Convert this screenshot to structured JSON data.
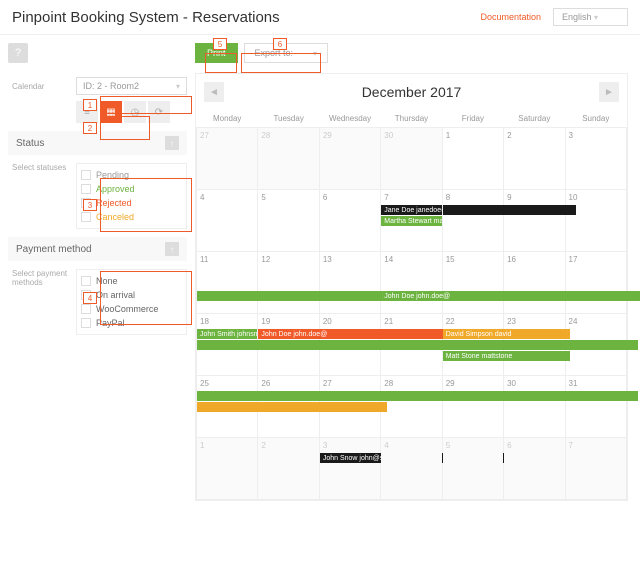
{
  "header": {
    "title": "Pinpoint Booking System - Reservations",
    "docLink": "Documentation",
    "lang": "English"
  },
  "toolbar": {
    "print": "Print",
    "export": "Export to:"
  },
  "sidebar": {
    "calendarLabel": "Calendar",
    "calendarSelect": "ID: 2 - Room2",
    "statusHeader": "Status",
    "statusLabel": "Select statuses",
    "statuses": {
      "pending": "Pending",
      "approved": "Approved",
      "rejected": "Rejected",
      "canceled": "Canceled"
    },
    "paymentHeader": "Payment method",
    "paymentLabel": "Select payment methods",
    "payments": {
      "none": "None",
      "arrival": "On arrival",
      "woo": "WooCommerce",
      "paypal": "PayPal"
    }
  },
  "callouts": {
    "c1": "1",
    "c2": "2",
    "c3": "3",
    "c4": "4",
    "c5": "5",
    "c6": "6"
  },
  "calendar": {
    "title": "December 2017",
    "days": [
      "Monday",
      "Tuesday",
      "Wednesday",
      "Thursday",
      "Friday",
      "Saturday",
      "Sunday"
    ],
    "cells": [
      [
        "27",
        "28",
        "29",
        "30",
        "1",
        "2",
        "3"
      ],
      [
        "4",
        "5",
        "6",
        "7",
        "8",
        "9",
        "10"
      ],
      [
        "11",
        "12",
        "13",
        "14",
        "15",
        "16",
        "17"
      ],
      [
        "18",
        "19",
        "20",
        "21",
        "22",
        "23",
        "24"
      ],
      [
        "25",
        "26",
        "27",
        "28",
        "29",
        "30",
        "31"
      ],
      [
        "1",
        "2",
        "3",
        "4",
        "5",
        "6",
        "7"
      ]
    ],
    "events": {
      "janeDoe": "Jane Doe janedoe@c",
      "martha": "Martha Stewart mart",
      "johnDoe": "John Doe john.doe@",
      "johnSmith": "John Smith johnsmith",
      "johnDoe2": "John Doe john.doe@",
      "davidSimpson": "David Simpson david",
      "mattStone": "Matt Stone mattstone",
      "johnSnow": "John Snow john@star"
    }
  }
}
